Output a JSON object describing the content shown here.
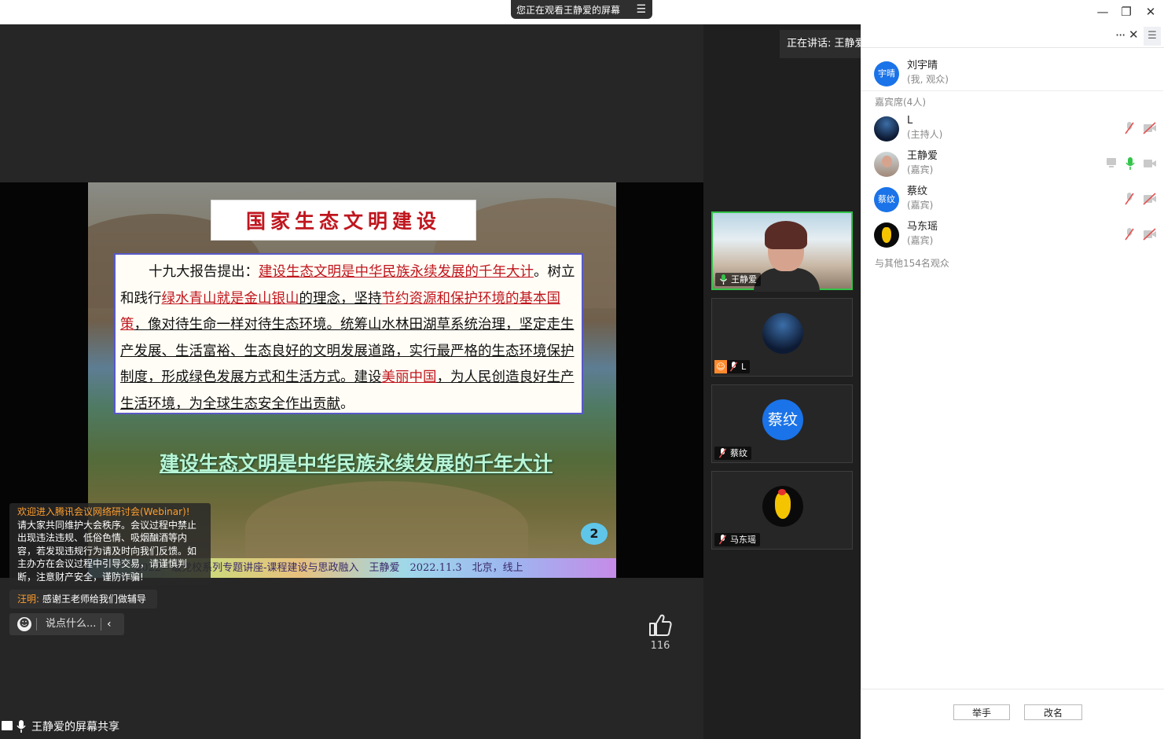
{
  "window": {
    "watching_label": "您正在观看王静爱的屏幕",
    "menu_icon": "menu-icon",
    "controls": [
      "minimize-icon",
      "restore-icon",
      "close-icon"
    ]
  },
  "slide": {
    "title": "国家生态文明建设",
    "intro": "十九大报告提出：",
    "hl1": "建设生态文明是中华民族永续发展的千年大计",
    "p1": "。",
    "p2": "树立和践行",
    "hl2": "绿水青山就是金山银山",
    "p3": "的理念，坚持",
    "hl3": "节约资源和保护环境的基本国策",
    "p4": "，像对待生命一样对待生态环境。统筹山水林田湖草系统治理，坚定走生产发展、生活富裕、生态良好的文明发展道路，实行最严格的生态环境保护制度，形成绿色发展方式和生活方式。建设",
    "hl4": "美丽中国",
    "p5": "，为人民创造良好生产生活环境，为全球生态安全作出贡献",
    "p6": "。",
    "heading": "建设生态文明是中华民族永续发展的千年大计",
    "page_number": "2",
    "footer": "2022—级党校系列专题讲座-课程建设与思政融入　王静爱　2022.11.3　北京，线上"
  },
  "chat": {
    "notice_title": "欢迎进入腾讯会议网络研讨会(Webinar)!",
    "notice_body": "请大家共同维护大会秩序。会议过程中禁止出现违法违规、低俗色情、吸烟酗酒等内容，若发现违规行为请及时向我们反馈。如主办方在会议过程中引导交易，请谨慎判断，注意财产安全，谨防诈骗!",
    "message_author": "汪明:",
    "message_text": "感谢王老师给我们做辅导",
    "input_placeholder": "说点什么...",
    "collapse_glyph": "‹"
  },
  "like": {
    "count": "116"
  },
  "share_label": "王静爱的屏幕共享",
  "speaking": "正在讲话: 王静爱;",
  "tiles": [
    {
      "name": "王静爱",
      "active": true
    },
    {
      "name": "L"
    },
    {
      "name": "蔡纹",
      "avatar_text": "蔡纹",
      "avatar_color": "#1a73e8"
    },
    {
      "name": "马东瑶"
    }
  ],
  "panel": {
    "self": {
      "name": "刘宇晴",
      "role": "(我, 观众)",
      "avatar_text": "宇晴",
      "avatar_color": "#1a73e8"
    },
    "guests_header": "嘉宾席(4人)",
    "guests": [
      {
        "name": "L",
        "role": "(主持人)"
      },
      {
        "name": "王静爱",
        "role": "(嘉宾)"
      },
      {
        "name": "蔡纹",
        "role": "(嘉宾)",
        "avatar_text": "蔡纹"
      },
      {
        "name": "马东瑶",
        "role": "(嘉宾)"
      }
    ],
    "others": "与其他154名观众",
    "raise_hand": "举手",
    "rename": "改名"
  },
  "colors": {
    "accent_blue": "#1a73e8",
    "speaking_green": "#33c44a",
    "muted_red": "#e25252",
    "notice_orange": "#ff9f2e"
  }
}
